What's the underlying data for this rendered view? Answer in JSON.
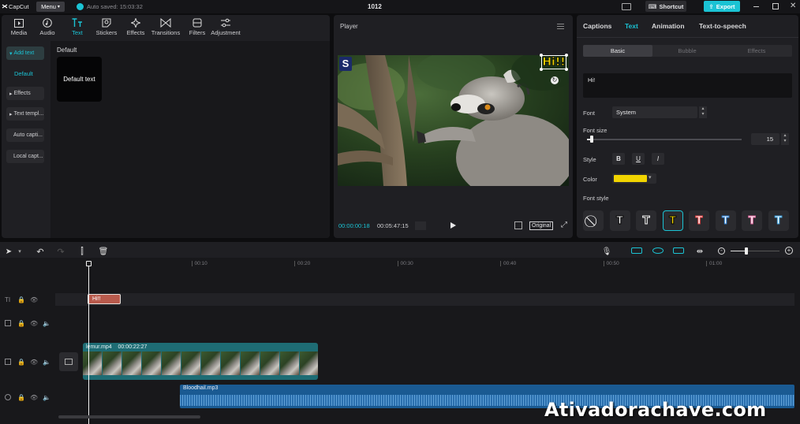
{
  "app": {
    "name": "CapCut",
    "menu_label": "Menu",
    "autosave": "Auto saved: 15:03:32",
    "project_title": "1012",
    "shortcut_label": "Shortcut",
    "export_label": "Export"
  },
  "colors": {
    "accent": "#1bc3d4",
    "text_yellow": "#f1d400",
    "clip_text": "#b85a4c",
    "clip_video": "#1e6c74",
    "clip_audio": "#1a5a92"
  },
  "toolbar": [
    {
      "label": "Media",
      "icon": "media-icon"
    },
    {
      "label": "Audio",
      "icon": "audio-icon"
    },
    {
      "label": "Text",
      "icon": "text-icon"
    },
    {
      "label": "Stickers",
      "icon": "stickers-icon"
    },
    {
      "label": "Effects",
      "icon": "effects-icon"
    },
    {
      "label": "Transitions",
      "icon": "transitions-icon"
    },
    {
      "label": "Filters",
      "icon": "filters-icon"
    },
    {
      "label": "Adjustment",
      "icon": "adjustment-icon"
    }
  ],
  "left_nav": {
    "add_text": "Add text",
    "default": "Default",
    "effects": "Effects",
    "text_templates": "Text templ...",
    "auto_captions": "Auto capti...",
    "local_captions": "Local capt..."
  },
  "library": {
    "section": "Default",
    "card": "Default text"
  },
  "player": {
    "title": "Player",
    "overlay_text": "Hi!!",
    "watermark": "S",
    "current_time": "00:00:00:18",
    "duration": "00:05:47:15",
    "ratio": "Original"
  },
  "inspector": {
    "tabs": [
      "Captions",
      "Text",
      "Animation",
      "Text-to-speech"
    ],
    "subtabs": [
      "Basic",
      "Bubble",
      "Effects"
    ],
    "text_value": "Hi!",
    "font_label": "Font",
    "font_value": "System",
    "font_size_label": "Font size",
    "font_size_value": "15",
    "font_size_fraction": 0.03,
    "style_label": "Style",
    "style_buttons": [
      "B",
      "U",
      "I"
    ],
    "color_label": "Color",
    "color_value": "#f1d400",
    "font_style_label": "Font style",
    "presets": [
      {
        "glyph": "⃠",
        "fill": "#ffffff",
        "stroke": "none"
      },
      {
        "glyph": "T",
        "fill": "#ffffff",
        "stroke": "#000000"
      },
      {
        "glyph": "T",
        "fill": "#111111",
        "stroke": "#ffffff"
      },
      {
        "glyph": "T",
        "fill": "#f1d400",
        "stroke": "#000000"
      },
      {
        "glyph": "T",
        "fill": "#ffffff",
        "stroke": "#e44"
      },
      {
        "glyph": "T",
        "fill": "#ffffff",
        "stroke": "#2a7fd6"
      },
      {
        "glyph": "T",
        "fill": "#ffffff",
        "stroke": "#e56aa0"
      },
      {
        "glyph": "T",
        "fill": "#ffffff",
        "stroke": "#3aa0e0"
      }
    ]
  },
  "timeline": {
    "ticks": [
      "00:00",
      "00:10",
      "00:20",
      "00:30",
      "00:40",
      "00:50",
      "01:00"
    ],
    "text_clip": "Hi!!",
    "video_name": "lemur.mp4",
    "video_duration": "00:00:22:27",
    "audio_name": "Bloodhail.mp3"
  },
  "watermark_text": "Ativadorachave.com"
}
